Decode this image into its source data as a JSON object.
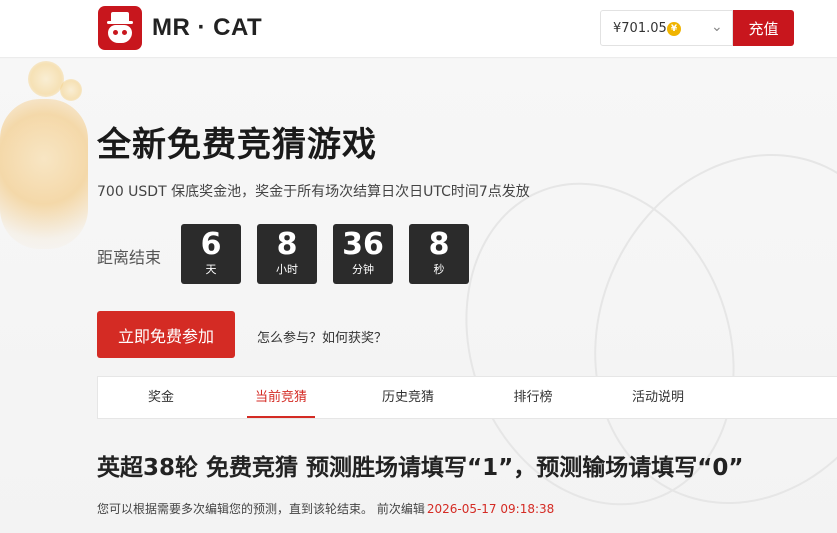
{
  "header": {
    "brand": "MR · CAT",
    "balance": "¥701.05",
    "coin_symbol": "¥",
    "recharge_label": "充值"
  },
  "hero": {
    "title": "全新免费竞猜游戏",
    "subtitle": "700 USDT 保底奖金池，奖金于所有场次结算日次日UTC时间7点发放",
    "countdown_label": "距离结束",
    "countdown": [
      {
        "value": "6",
        "unit": "天"
      },
      {
        "value": "8",
        "unit": "小时"
      },
      {
        "value": "36",
        "unit": "分钟"
      },
      {
        "value": "8",
        "unit": "秒"
      }
    ],
    "join_label": "立即免费参加",
    "how_link": "怎么参与？如何获奖？"
  },
  "tabs": [
    {
      "label": "奖金"
    },
    {
      "label": "当前竞猜",
      "active": true
    },
    {
      "label": "历史竞猜"
    },
    {
      "label": "排行榜"
    },
    {
      "label": "活动说明"
    }
  ],
  "main": {
    "section_title": "英超38轮 免费竞猜 预测胜场请填写“1”，预测输场请填写“0”",
    "note_text": "您可以根据需要多次编辑您的预测，直到该轮结束。 前次编辑",
    "last_edit_time": "2026-05-17 09:18:38"
  },
  "colors": {
    "accent": "#d42b24",
    "brand_red": "#c8161d",
    "countdown_bg": "#2b2b2b",
    "coin": "#f0b400"
  },
  "icons": {
    "coin": "yen-coin-icon",
    "dropdown": "chevron-down-icon",
    "logo": "cat-hat-logo-icon"
  }
}
